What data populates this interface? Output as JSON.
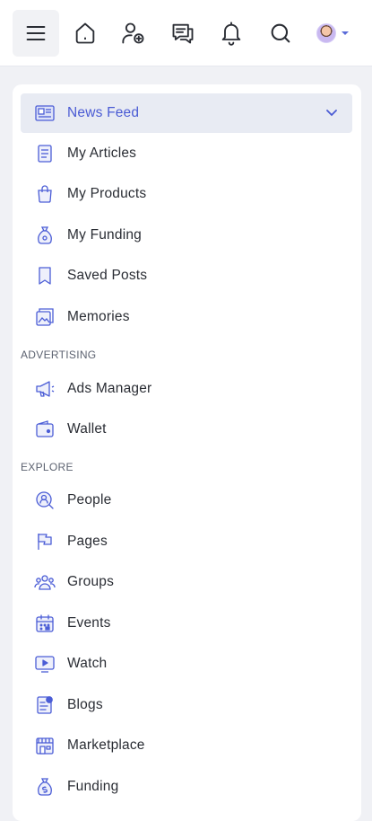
{
  "topbar": {
    "icons": [
      "menu-icon",
      "home-icon",
      "add-friend-icon",
      "messages-icon",
      "bell-icon",
      "search-icon",
      "avatar"
    ]
  },
  "sidebar": {
    "main_items": [
      {
        "label": "News Feed",
        "icon": "news-feed-icon",
        "active": true
      },
      {
        "label": "My Articles",
        "icon": "articles-icon"
      },
      {
        "label": "My Products",
        "icon": "products-icon"
      },
      {
        "label": "My Funding",
        "icon": "funding-icon"
      },
      {
        "label": "Saved Posts",
        "icon": "saved-posts-icon"
      },
      {
        "label": "Memories",
        "icon": "memories-icon"
      }
    ],
    "advertising": {
      "title": "ADVERTISING",
      "items": [
        {
          "label": "Ads Manager",
          "icon": "megaphone-icon"
        },
        {
          "label": "Wallet",
          "icon": "wallet-icon"
        }
      ]
    },
    "explore": {
      "title": "EXPLORE",
      "items": [
        {
          "label": "People",
          "icon": "people-search-icon"
        },
        {
          "label": "Pages",
          "icon": "flag-icon"
        },
        {
          "label": "Groups",
          "icon": "groups-icon"
        },
        {
          "label": "Events",
          "icon": "calendar-icon"
        },
        {
          "label": "Watch",
          "icon": "watch-icon"
        },
        {
          "label": "Blogs",
          "icon": "blogs-icon"
        },
        {
          "label": "Marketplace",
          "icon": "marketplace-icon"
        },
        {
          "label": "Funding",
          "icon": "money-bag-icon"
        }
      ]
    }
  },
  "colors": {
    "accent": "#4a5bd4",
    "icon_stroke": "#4b5dd6",
    "active_bg": "#e8ebf3",
    "page_bg": "#f0f1f5"
  }
}
